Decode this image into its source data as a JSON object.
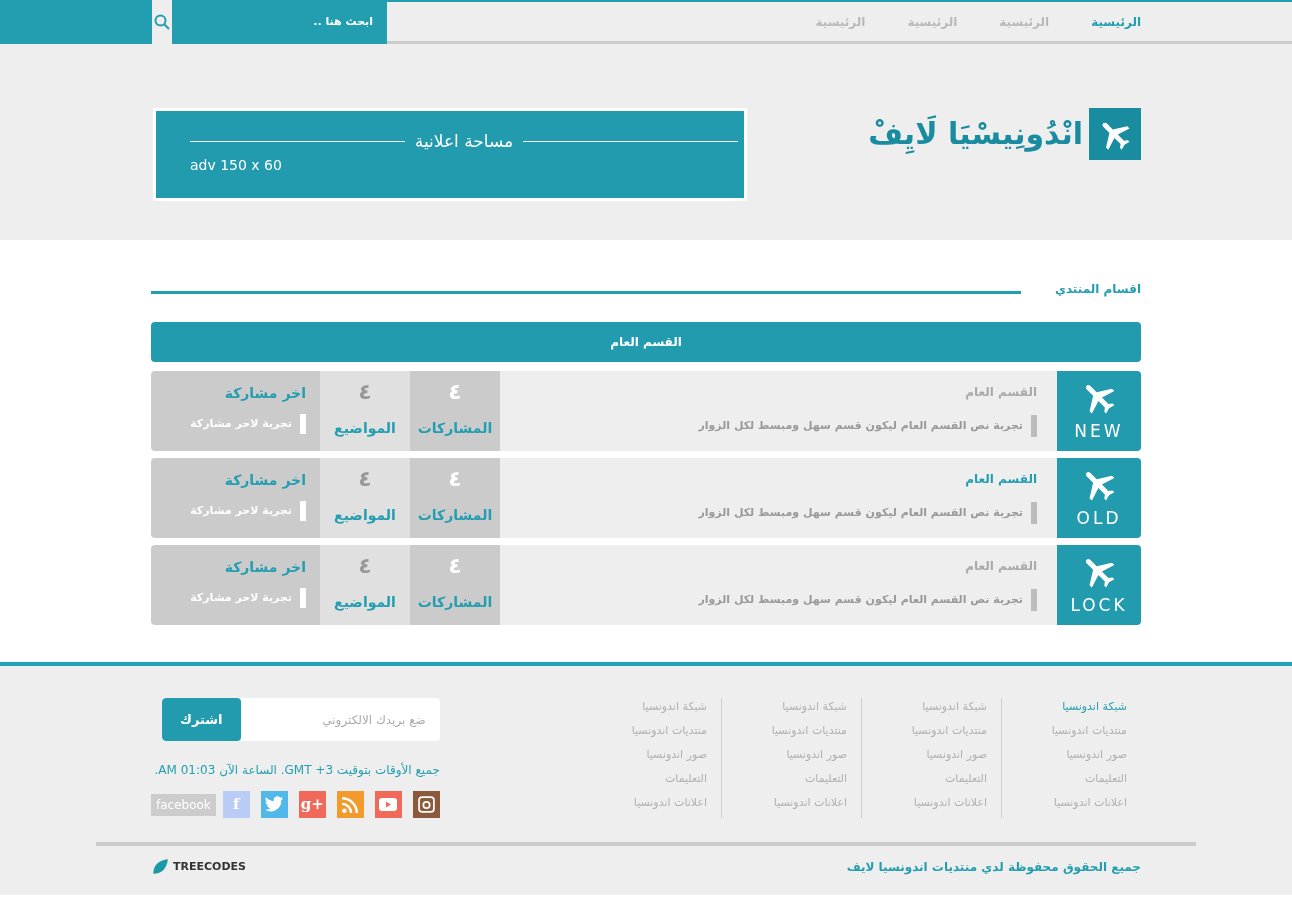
{
  "nav": {
    "links": [
      {
        "label": "الرئيسية",
        "selected": true
      },
      {
        "label": "الرئيسية",
        "selected": false
      },
      {
        "label": "الرئيسية",
        "selected": false
      },
      {
        "label": "الرئيسية",
        "selected": false
      }
    ],
    "search": {
      "placeholder": "ابحث هنا .."
    }
  },
  "header": {
    "logo": "انْدُونِيسْيَا لَايِفْ",
    "ad": {
      "title": "مساحة اعلانية",
      "size": "adv 150 x 60"
    }
  },
  "section": {
    "title": "اقسام المنتدي",
    "category": "القسم العام",
    "forums": [
      {
        "badge": "NEW",
        "name": "القسم العام",
        "highlighted": false,
        "description": "تجربة نص القسم العام ليكون قسم سهل ومبسط لكل الزوار",
        "posts": "٤",
        "posts_label": "المشاركات",
        "topics": "٤",
        "topics_label": "المواضيع",
        "last_post_label": "اخر مشاركة",
        "last_post": "تجربة لاحر مشاركة"
      },
      {
        "badge": "OLD",
        "name": "القسم العام",
        "highlighted": true,
        "description": "تجربة نص القسم العام ليكون قسم سهل ومبسط لكل الزوار",
        "posts": "٤",
        "posts_label": "المشاركات",
        "topics": "٤",
        "topics_label": "المواضيع",
        "last_post_label": "اخر مشاركة",
        "last_post": "تجربة لاحر مشاركة"
      },
      {
        "badge": "LOCK",
        "name": "القسم العام",
        "highlighted": false,
        "description": "تجربة نص القسم العام ليكون قسم سهل ومبسط لكل الزوار",
        "posts": "٤",
        "posts_label": "المشاركات",
        "topics": "٤",
        "topics_label": "المواضيع",
        "last_post_label": "اخر مشاركة",
        "last_post": "تجربة لاحر مشاركة"
      }
    ]
  },
  "footer": {
    "link_columns": [
      {
        "links": [
          {
            "label": "شبكة اندونسيا",
            "selected": true
          },
          {
            "label": "منتديات اندونسيا",
            "selected": false
          },
          {
            "label": "صور اندونسيا",
            "selected": false
          },
          {
            "label": "التعليمات",
            "selected": false
          },
          {
            "label": "اعلانات اندونسيا",
            "selected": false
          }
        ]
      },
      {
        "links": [
          {
            "label": "شبكة اندونسيا",
            "selected": false
          },
          {
            "label": "منتديات اندونسيا",
            "selected": false
          },
          {
            "label": "صور اندونسيا",
            "selected": false
          },
          {
            "label": "التعليمات",
            "selected": false
          },
          {
            "label": "اعلانات اندونسيا",
            "selected": false
          }
        ]
      },
      {
        "links": [
          {
            "label": "شبكة اندونسيا",
            "selected": false
          },
          {
            "label": "منتديات اندونسيا",
            "selected": false
          },
          {
            "label": "صور اندونسيا",
            "selected": false
          },
          {
            "label": "التعليمات",
            "selected": false
          },
          {
            "label": "اعلانات اندونسيا",
            "selected": false
          }
        ]
      },
      {
        "links": [
          {
            "label": "شبكة اندونسيا",
            "selected": false
          },
          {
            "label": "منتديات اندونسيا",
            "selected": false
          },
          {
            "label": "صور اندونسيا",
            "selected": false
          },
          {
            "label": "التعليمات",
            "selected": false
          },
          {
            "label": "اعلانات اندونسيا",
            "selected": false
          }
        ]
      }
    ],
    "newsletter": {
      "placeholder": "ضع بريدك الالكتروني",
      "button": "اشترك"
    },
    "timezone": "جميع الأوقات بتوقيت GMT +3. الساعة الآن 01:03 AM.",
    "social": [
      {
        "kind": "instagram",
        "color": "#8b5a3c"
      },
      {
        "kind": "youtube",
        "color": "#f06a5a"
      },
      {
        "kind": "rss",
        "color": "#f39a2c"
      },
      {
        "kind": "googleplus",
        "color": "#f0695a",
        "glyph": "g+"
      },
      {
        "kind": "twitter",
        "color": "#52b8ea"
      },
      {
        "kind": "facebook",
        "color": "#b8ccf5",
        "glyph": "f"
      }
    ],
    "social_tooltip": "facebook",
    "copyright": "جميع الحقوق محفوظة لدي منتديات اندونسيا لايف",
    "credit": "TREECODES"
  }
}
